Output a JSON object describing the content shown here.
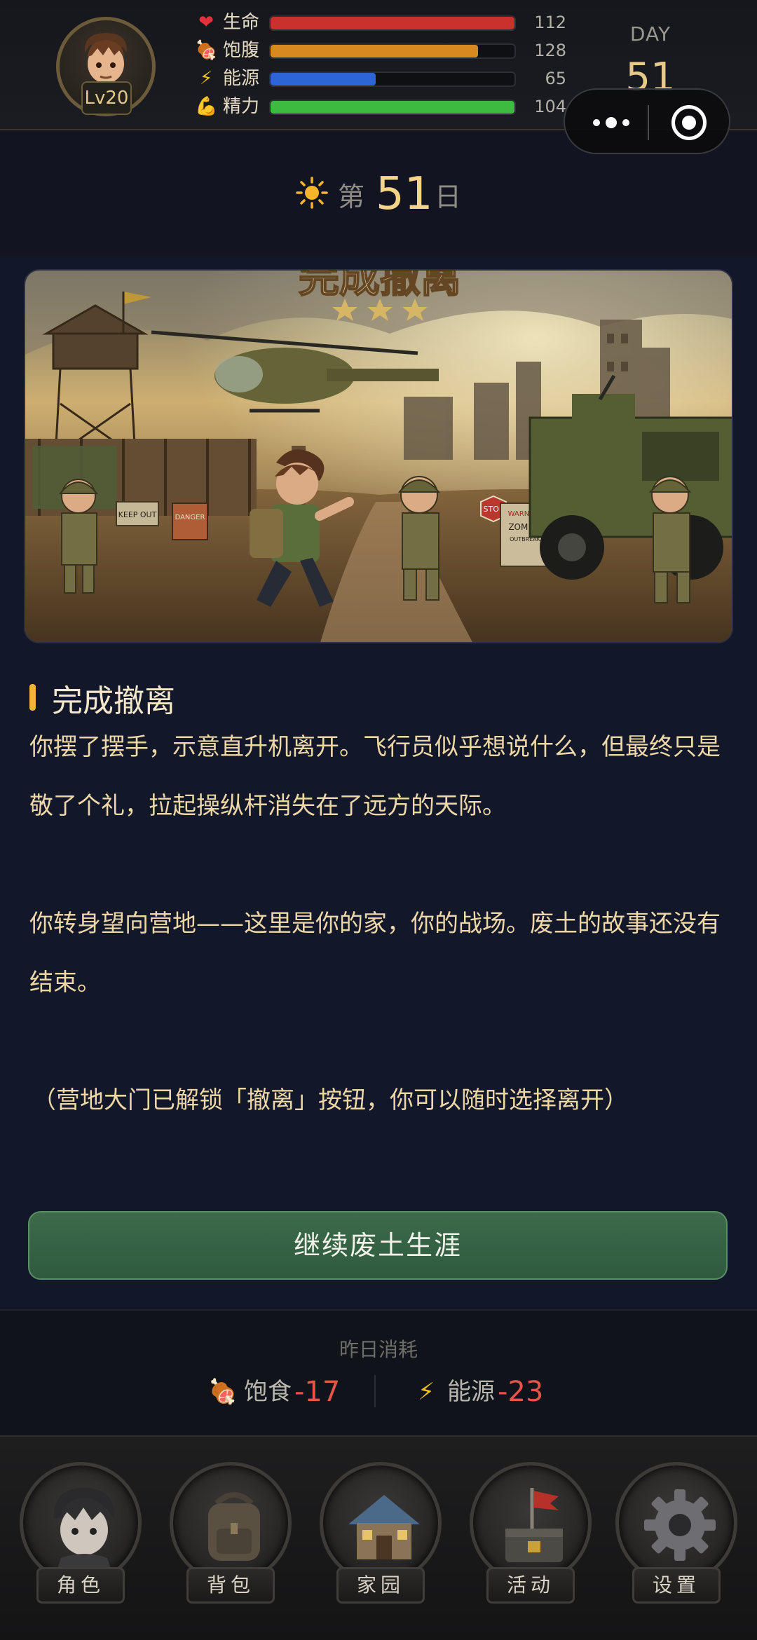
{
  "status": {
    "level": "Lv20",
    "stats": [
      {
        "icon": "heart-icon",
        "glyph": "❤",
        "label": "生命",
        "value": "112",
        "fill": 1.0,
        "color": "#c8312c"
      },
      {
        "icon": "meat-icon",
        "glyph": "🍖",
        "label": "饱腹",
        "value": "128",
        "fill": 0.85,
        "color": "#d88a21"
      },
      {
        "icon": "lightning-icon",
        "glyph": "⚡",
        "label": "能源",
        "value": "65",
        "fill": 0.43,
        "color": "#2c66d6"
      },
      {
        "icon": "muscle-icon",
        "glyph": "💪",
        "label": "精力",
        "value": "104",
        "fill": 1.0,
        "color": "#3dbb3f"
      }
    ],
    "day_label": "DAY",
    "day_number": "51"
  },
  "day_header": {
    "prefix": "第",
    "number": "51",
    "suffix": "日"
  },
  "event": {
    "banner_text": "完成撤离",
    "title": "完成撤离",
    "paragraphs": [
      "你摆了摆手，示意直升机离开。飞行员似乎想说什么，但最终只是敬了个礼，拉起操纵杆消失在了远方的天际。",
      "你转身望向营地——这里是你的家，你的战场。废土的故事还没有结束。",
      "（营地大门已解锁「撤离」按钮，你可以随时选择离开）"
    ],
    "signs": [
      "KEEP OUT",
      "DANGER",
      "STOP",
      "WARNING",
      "ZOMBIE",
      "OUTBREAK"
    ],
    "continue_label": "继续废土生涯"
  },
  "consumption": {
    "title": "昨日消耗",
    "items": [
      {
        "icon": "meat-icon",
        "glyph": "🍖",
        "label": "饱食",
        "value": "-17"
      },
      {
        "icon": "lightning-icon",
        "glyph": "⚡",
        "label": "能源",
        "value": "-23"
      }
    ]
  },
  "nav": [
    {
      "label": "角色",
      "icon": "character-icon"
    },
    {
      "label": "背包",
      "icon": "backpack-icon"
    },
    {
      "label": "家园",
      "icon": "home-icon"
    },
    {
      "label": "活动",
      "icon": "activity-icon"
    },
    {
      "label": "设置",
      "icon": "settings-icon"
    }
  ]
}
